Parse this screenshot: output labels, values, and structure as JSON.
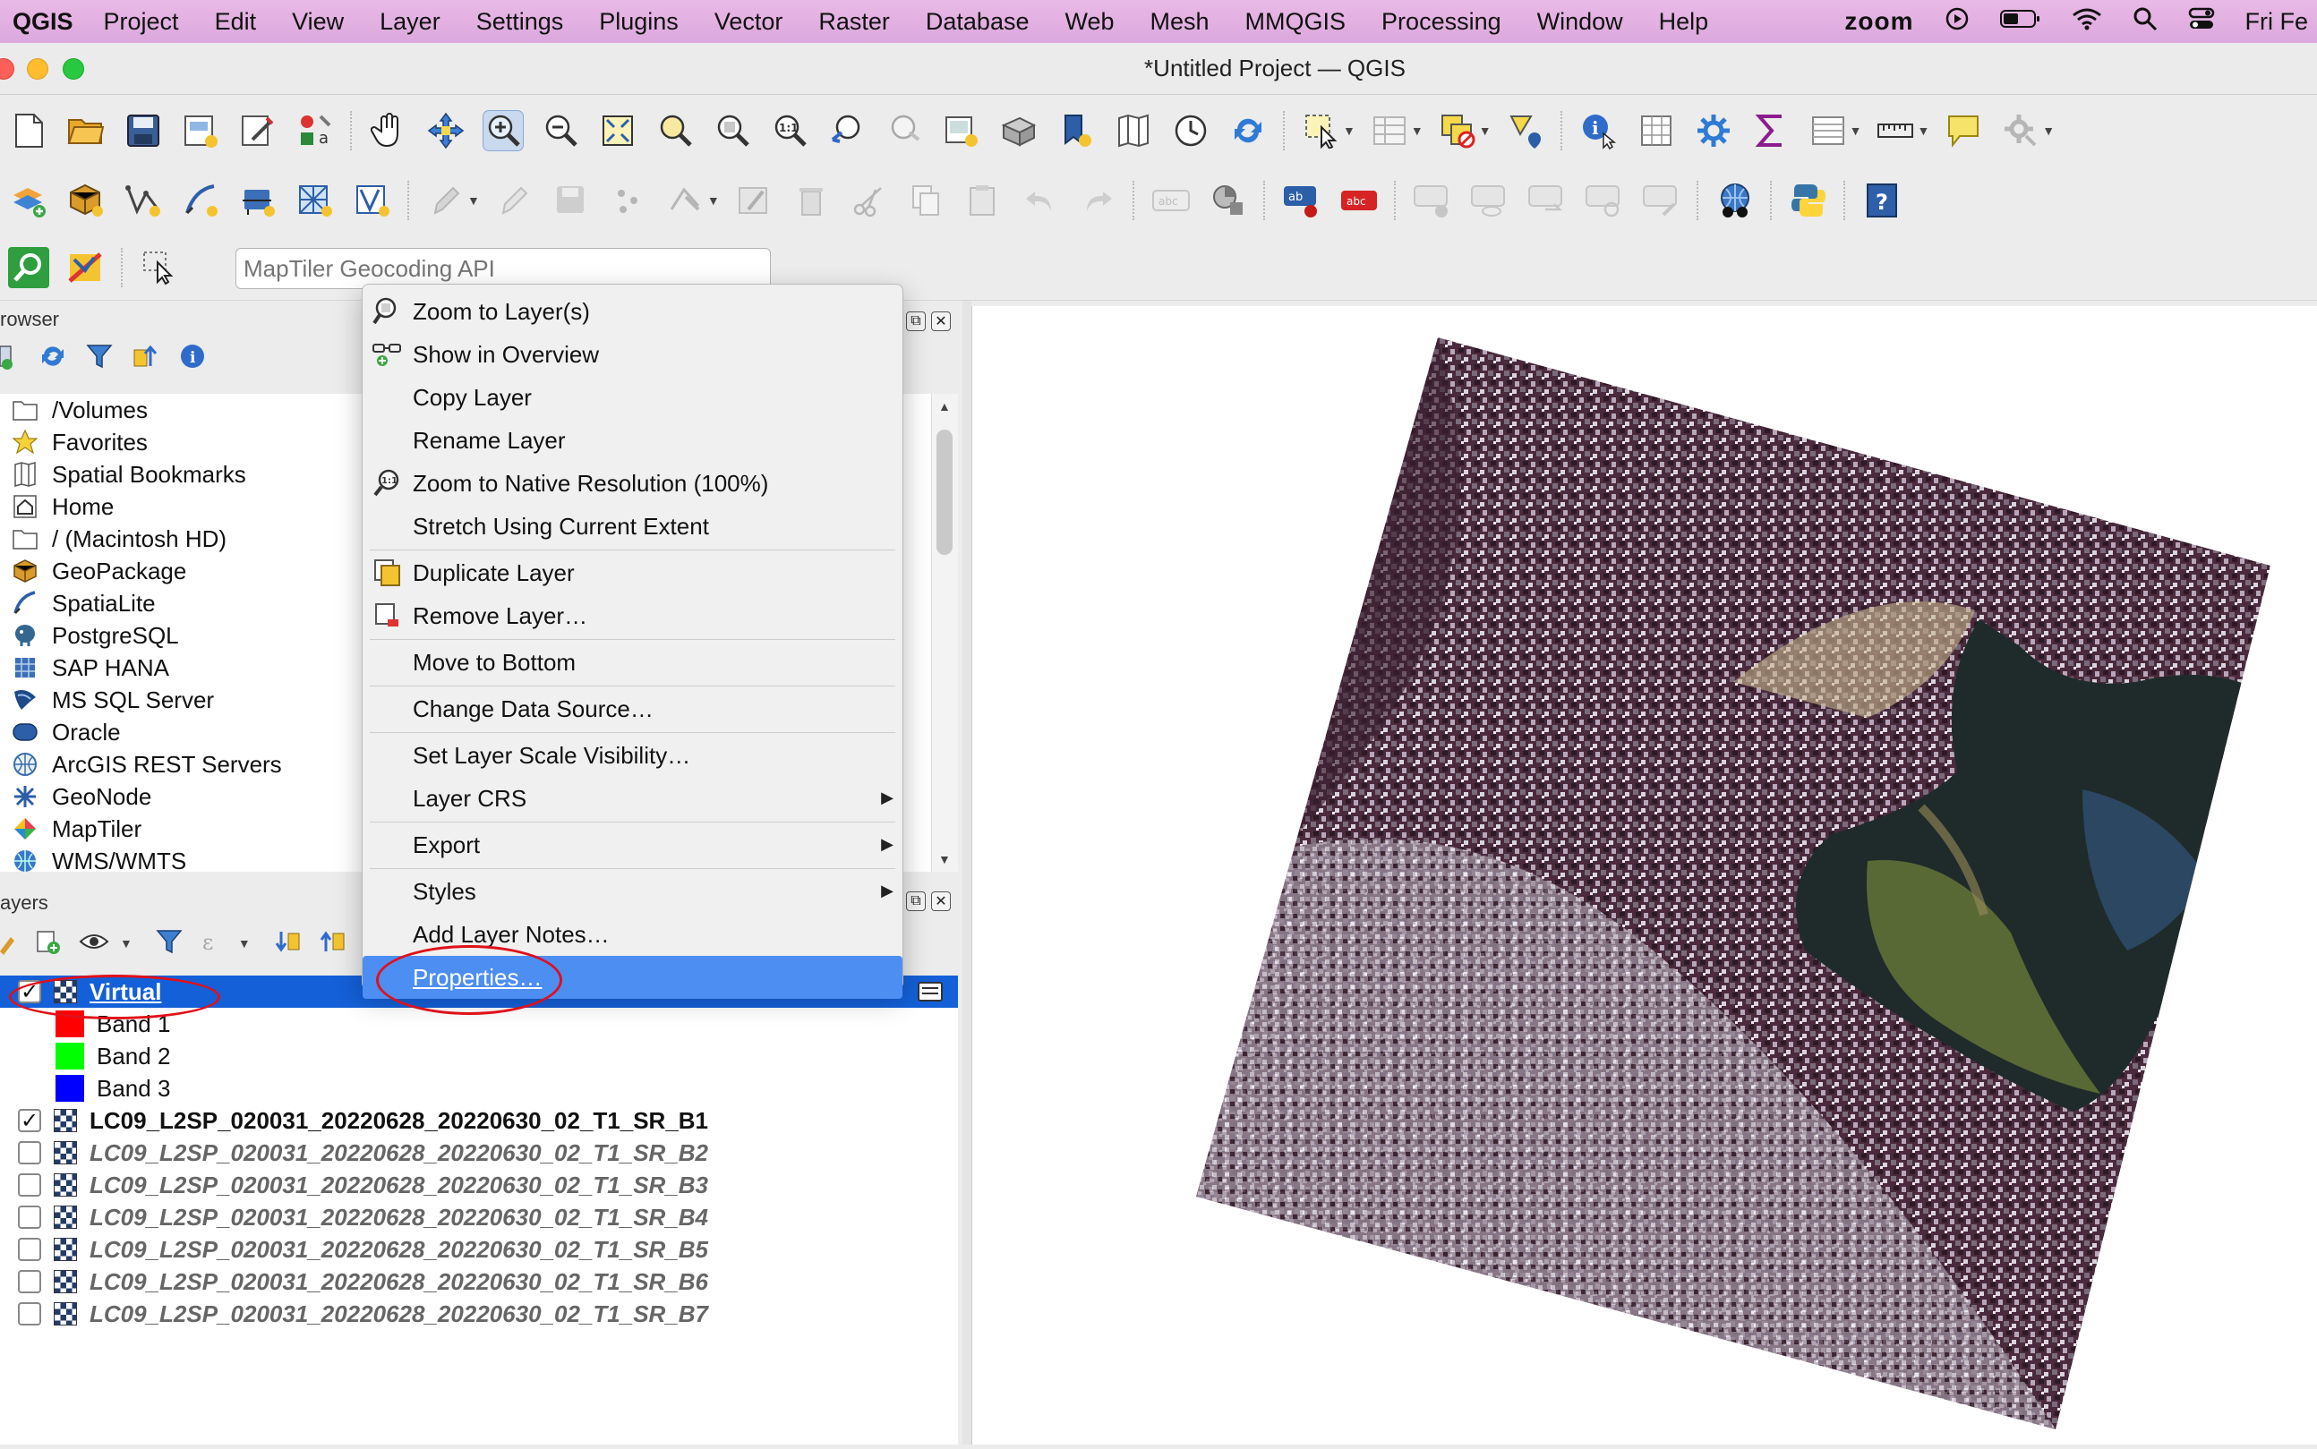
{
  "menubar": {
    "app": "QGIS",
    "items": [
      "Project",
      "Edit",
      "View",
      "Layer",
      "Settings",
      "Plugins",
      "Vector",
      "Raster",
      "Database",
      "Web",
      "Mesh",
      "MMQGIS",
      "Processing",
      "Window",
      "Help"
    ],
    "zoom_label": "zoom",
    "clock": "Fri Fe"
  },
  "window": {
    "title": "*Untitled Project — QGIS"
  },
  "locator": {
    "placeholder": "MapTiler Geocoding API"
  },
  "browser": {
    "title": "rowser",
    "items": [
      {
        "label": "/Volumes",
        "icon": "folder-icon"
      },
      {
        "label": "Favorites",
        "icon": "star-icon"
      },
      {
        "label": "Spatial Bookmarks",
        "icon": "bookmark-icon"
      },
      {
        "label": "Home",
        "icon": "home-icon"
      },
      {
        "label": "/ (Macintosh HD)",
        "icon": "folder-icon"
      },
      {
        "label": "GeoPackage",
        "icon": "geopackage-icon"
      },
      {
        "label": "SpatiaLite",
        "icon": "spatialite-icon"
      },
      {
        "label": "PostgreSQL",
        "icon": "postgresql-icon"
      },
      {
        "label": "SAP HANA",
        "icon": "sap-hana-icon"
      },
      {
        "label": "MS SQL Server",
        "icon": "mssql-icon"
      },
      {
        "label": "Oracle",
        "icon": "oracle-icon"
      },
      {
        "label": "ArcGIS REST Servers",
        "icon": "arcgis-icon"
      },
      {
        "label": "GeoNode",
        "icon": "geonode-icon"
      },
      {
        "label": "MapTiler",
        "icon": "maptiler-icon"
      },
      {
        "label": "WMS/WMTS",
        "icon": "wms-icon"
      }
    ]
  },
  "layers": {
    "title": "ayers",
    "rows": [
      {
        "name": "Virtual",
        "checked": true,
        "type": "raster",
        "selected": true
      },
      {
        "name": "Band 1",
        "type": "band",
        "color": "#ff0000"
      },
      {
        "name": "Band 2",
        "type": "band",
        "color": "#00ff00"
      },
      {
        "name": "Band 3",
        "type": "band",
        "color": "#0000ff"
      },
      {
        "name": "LC09_L2SP_020031_20220628_20220630_02_T1_SR_B1",
        "checked": true,
        "type": "raster"
      },
      {
        "name": "LC09_L2SP_020031_20220628_20220630_02_T1_SR_B2",
        "checked": false,
        "type": "raster"
      },
      {
        "name": "LC09_L2SP_020031_20220628_20220630_02_T1_SR_B3",
        "checked": false,
        "type": "raster"
      },
      {
        "name": "LC09_L2SP_020031_20220628_20220630_02_T1_SR_B4",
        "checked": false,
        "type": "raster"
      },
      {
        "name": "LC09_L2SP_020031_20220628_20220630_02_T1_SR_B5",
        "checked": false,
        "type": "raster"
      },
      {
        "name": "LC09_L2SP_020031_20220628_20220630_02_T1_SR_B6",
        "checked": false,
        "type": "raster"
      },
      {
        "name": "LC09_L2SP_020031_20220628_20220630_02_T1_SR_B7",
        "checked": false,
        "type": "raster"
      }
    ]
  },
  "context_menu": {
    "items": [
      {
        "label": "Zoom to Layer(s)",
        "icon": "zoom-layer-icon"
      },
      {
        "label": "Show in Overview",
        "icon": "overview-icon"
      },
      {
        "label": "Copy Layer"
      },
      {
        "label": "Rename Layer"
      },
      {
        "label": "Zoom to Native Resolution (100%)",
        "icon": "native-res-icon"
      },
      {
        "label": "Stretch Using Current Extent"
      },
      {
        "separator": true
      },
      {
        "label": "Duplicate Layer",
        "icon": "duplicate-icon"
      },
      {
        "label": "Remove Layer…",
        "icon": "remove-layer-icon"
      },
      {
        "separator": true
      },
      {
        "label": "Move to Bottom"
      },
      {
        "separator": true
      },
      {
        "label": "Change Data Source…"
      },
      {
        "separator": true
      },
      {
        "label": "Set Layer Scale Visibility…"
      },
      {
        "label": "Layer CRS",
        "submenu": true
      },
      {
        "separator": true
      },
      {
        "label": "Export",
        "submenu": true
      },
      {
        "separator": true
      },
      {
        "label": "Styles",
        "submenu": true
      },
      {
        "label": "Add Layer Notes…"
      },
      {
        "label": "Properties…",
        "highlighted": true
      }
    ]
  },
  "colors": {
    "selection": "#1460d8",
    "menu_highlight": "#4d8ef2",
    "annotation": "#e0101a"
  }
}
